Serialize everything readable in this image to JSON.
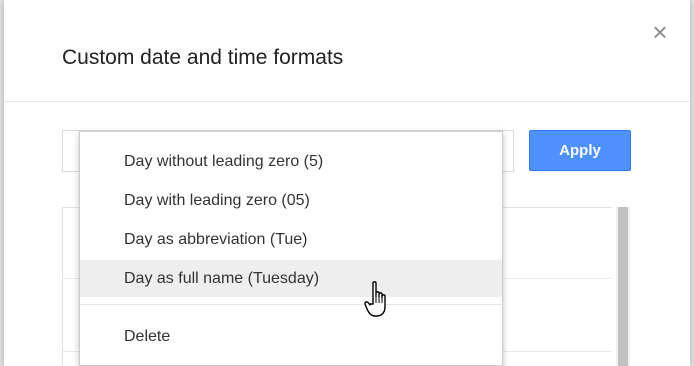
{
  "dialog": {
    "title": "Custom date and time formats",
    "close_symbol": "×",
    "apply_label": "Apply"
  },
  "menu": {
    "items": [
      {
        "label": "Day without leading zero (5)"
      },
      {
        "label": "Day with leading zero (05)"
      },
      {
        "label": "Day as abbreviation (Tue)"
      },
      {
        "label": "Day as full name (Tuesday)"
      }
    ],
    "delete_label": "Delete"
  },
  "icons": {
    "close": "close-icon",
    "cursor": "hand-pointer-icon"
  },
  "colors": {
    "apply_button": "#4d90fe",
    "hover_row": "#eeeeee"
  }
}
